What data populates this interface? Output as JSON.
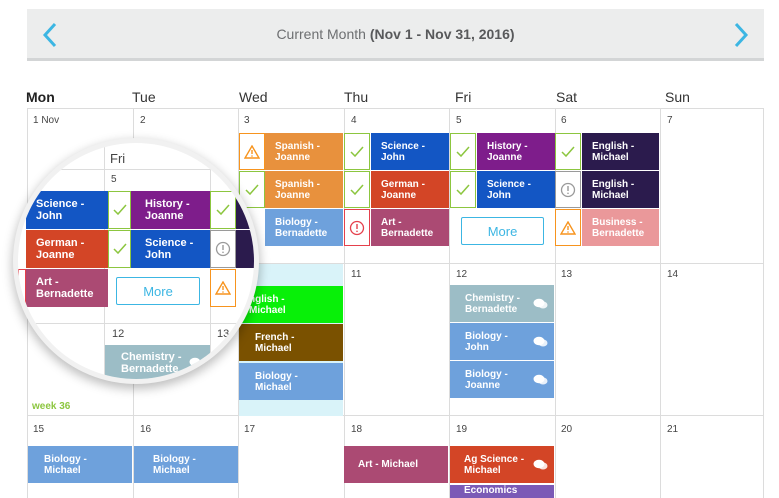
{
  "header": {
    "title_prefix": "Current Month ",
    "title_range": "(Nov 1 - Nov 31, 2016)",
    "prev_icon": "chevron-left-icon",
    "next_icon": "chevron-right-icon"
  },
  "days_of_week": [
    "Mon",
    "Tue",
    "Wed",
    "Thu",
    "Fri",
    "Sat",
    "Sun"
  ],
  "week_label": "week 36",
  "day_numbers": {
    "r1": [
      "1 Nov",
      "2",
      "3",
      "4",
      "5",
      "6",
      "7"
    ],
    "r2": [
      "11",
      "12",
      "13",
      "14"
    ],
    "r3": [
      "15",
      "16",
      "17",
      "18",
      "19",
      "20",
      "21"
    ]
  },
  "events": {
    "wed3_1": "Spanish -\nJoanne",
    "wed3_2": "Spanish -\nJoanne",
    "wed3_3": "Biology -\nBernadette",
    "thu4_1": "Science -\nJohn",
    "thu4_2": "German -\nJoanne",
    "thu4_3": "Art -\nBernadette",
    "fri5_1": "History -\nJoanne",
    "fri5_2": "Science -\nJohn",
    "sat6_1": "English -\nMichael",
    "sat6_2": "English -\nMichael",
    "sat6_3": "Business -\nBernadette",
    "wed10_1": "nglish -\nMichael",
    "wed10_2": "French -\nMichael",
    "wed10_3": "Biology -\nMichael",
    "fri12_1": "Chemistry -\nBernadette",
    "fri12_2": "Biology -\nJohn",
    "fri12_3": "Biology -\nJoanne",
    "mon15": "Biology -\nMichael",
    "tue16": "Biology -\nMichael",
    "thu18": "Art - Michael",
    "fri19_1": "Ag Science -\nMichael",
    "fri19_2": "Economics"
  },
  "more_label": "More",
  "magnifier": {
    "day_header": "Fri",
    "day_num_5": "5",
    "day_num_12": "12",
    "day_num_13": "13",
    "ev_1": "Science -\nJohn",
    "ev_2": "History -\nJoanne",
    "ev_3": "German -\nJoanne",
    "ev_4": "Science -\nJohn",
    "ev_5": "Art -\nBernadette",
    "ev_6": "Chemistry -\nBernadette",
    "more_label": "More"
  },
  "colors": {
    "spanish": "#e8913d",
    "biology": "#6ea1dc",
    "science": "#1356c4",
    "german": "#d34526",
    "art": "#ab4a73",
    "history": "#7e1d8b",
    "english": "#2b1b4d",
    "business": "#ea989a",
    "english_green": "#08f008",
    "french": "#7a5100",
    "chemistry": "#9cbdc6",
    "check": "#8cc63f",
    "accent": "#3cb6e3"
  }
}
